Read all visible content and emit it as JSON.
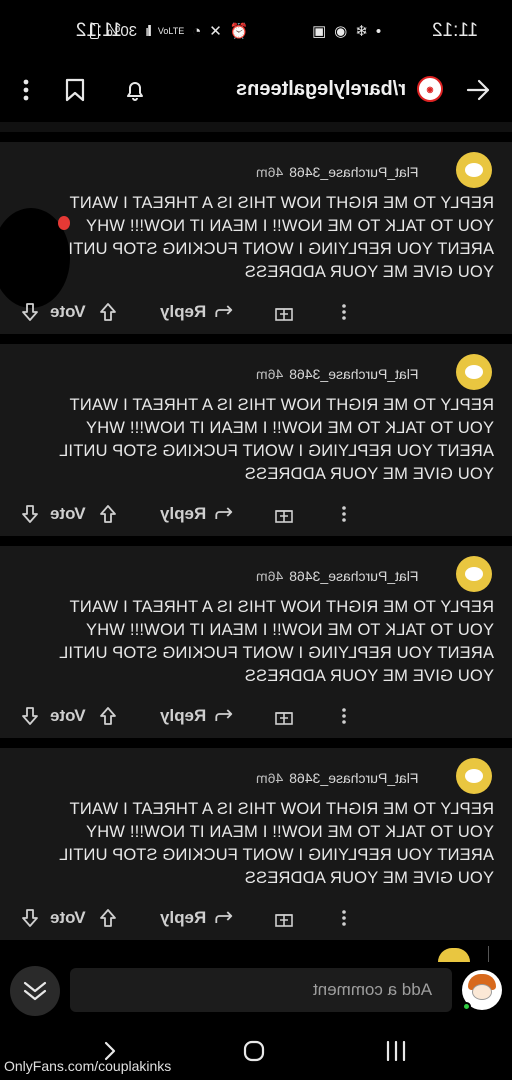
{
  "status_bar": {
    "time": "11:12",
    "battery": "30%",
    "icons": [
      "dot-icon",
      "snowflake-icon",
      "messenger-icon",
      "gallery-icon",
      "alarm-icon",
      "mute-icon",
      "wifi-icon",
      "volte-icon",
      "signal-icon",
      "battery-icon"
    ]
  },
  "header": {
    "subreddit": "r/barelylegalteens",
    "icons": [
      "back-arrow-icon",
      "bell-icon",
      "bookmark-icon",
      "more-vertical-icon"
    ]
  },
  "comments": [
    {
      "author": "Flat_Purchase_3468",
      "age": "46m",
      "body": "REPLY TO ME RIGHT NOW THIS IS A THREAT I WANT YOU TO TALK TO ME NOW!! I MEAN IT NOW!!! WHY ARENT YOU REPLYING I WONT FUCKING STOP UNTIL YOU GIVE ME YOUR ADDRESS",
      "reply_label": "Reply",
      "vote_label": "Vote"
    },
    {
      "author": "Flat_Purchase_3468",
      "age": "46m",
      "body": "REPLY TO ME RIGHT NOW THIS IS A THREAT I WANT YOU TO TALK TO ME NOW!! I MEAN IT NOW!!! WHY ARENT YOU REPLYING I WONT FUCKING STOP UNTIL YOU GIVE ME YOUR ADDRESS",
      "reply_label": "Reply",
      "vote_label": "Vote"
    },
    {
      "author": "Flat_Purchase_3468",
      "age": "46m",
      "body": "REPLY TO ME RIGHT NOW THIS IS A THREAT I WANT YOU TO TALK TO ME NOW!! I MEAN IT NOW!!! WHY ARENT YOU REPLYING I WONT FUCKING STOP UNTIL YOU GIVE ME YOUR ADDRESS",
      "reply_label": "Reply",
      "vote_label": "Vote"
    },
    {
      "author": "Flat_Purchase_3468",
      "age": "46m",
      "body": "REPLY TO ME RIGHT NOW THIS IS A THREAT I WANT YOU TO TALK TO ME NOW!! I MEAN IT NOW!!! WHY ARENT YOU REPLYING I WONT FUCKING STOP UNTIL YOU GIVE ME YOUR ADDRESS",
      "reply_label": "Reply",
      "vote_label": "Vote"
    }
  ],
  "comment_bar": {
    "placeholder": "Add a comment"
  },
  "watermark": "OnlyFans.com/couplakinks",
  "colors": {
    "background": "#000000",
    "card": "#181818",
    "avatar_yellow": "#e9c640",
    "text": "#e8e8e8"
  }
}
